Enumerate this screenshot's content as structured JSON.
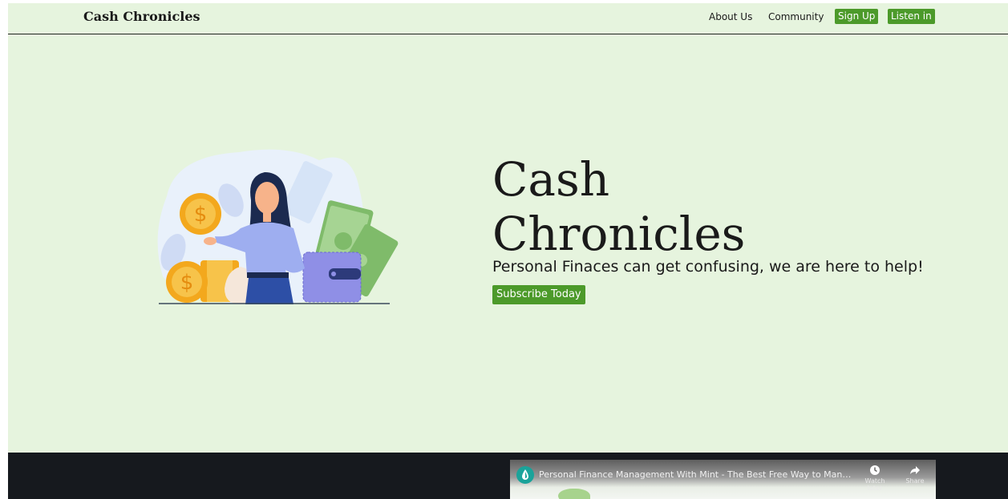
{
  "navbar": {
    "brand": "Cash Chronicles",
    "links": [
      "About Us",
      "Community"
    ],
    "signup_label": "Sign Up",
    "listen_label": "Listen in"
  },
  "hero": {
    "title_line1": "Cash",
    "title_line2": "Chronicles",
    "subtitle": "Personal Finaces can get confusing, we are here to help!",
    "cta_label": "Subscribe Today"
  },
  "video": {
    "title": "Personal Finance Management With Mint - The Best Free Way to Manage Your Mo...",
    "watch_later_label": "Watch later",
    "share_label": "Share"
  },
  "colors": {
    "background": "#e6f4de",
    "accent_green": "#4c9a2a",
    "dark_band": "#16191e"
  }
}
